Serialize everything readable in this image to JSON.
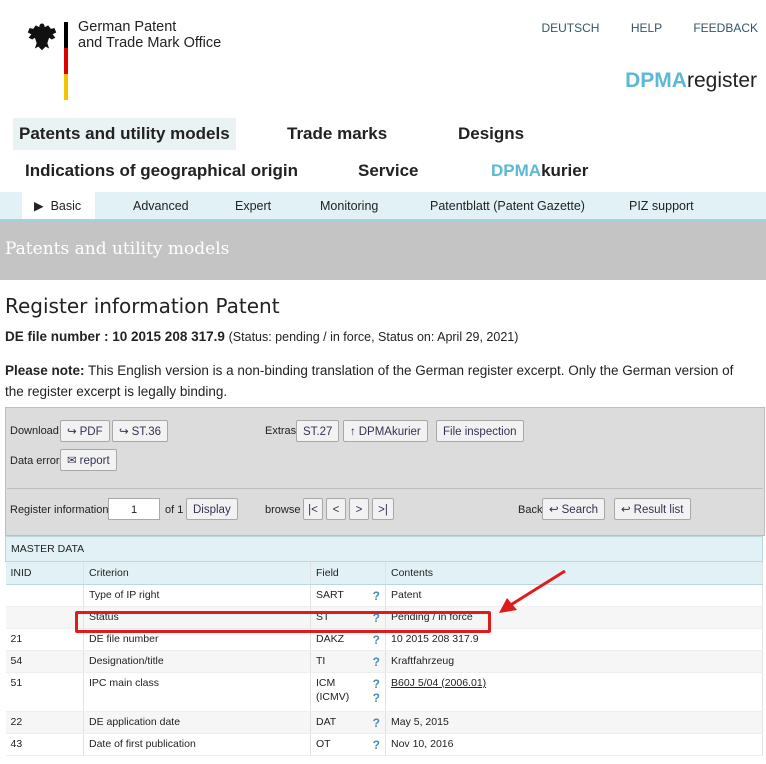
{
  "header": {
    "org_line1": "German Patent",
    "org_line2": "and Trade Mark Office",
    "links": [
      "DEUTSCH",
      "HELP",
      "FEEDBACK"
    ],
    "brand_a": "DPMA",
    "brand_b": "register",
    "colors": {
      "accent": "#5cb8d6",
      "flag": [
        "#000000",
        "#dd0000",
        "#f5c400"
      ]
    }
  },
  "main_nav": {
    "patents": "Patents and utility models",
    "trademarks": "Trade marks",
    "designs": "Designs",
    "geo": "Indications of geographical origin",
    "service": "Service",
    "kurier_a": "DPMA",
    "kurier_b": "kurier"
  },
  "sub_nav": {
    "basic": "Basic",
    "advanced": "Advanced",
    "expert": "Expert",
    "monitoring": "Monitoring",
    "gazette": "Patentblatt (Patent Gazette)",
    "piz": "PIZ support"
  },
  "band_title": "Patents and utility models",
  "page_title": "Register information Patent",
  "file": {
    "label": "DE file number : 10 2015 208 317.9",
    "status": "(Status: pending / in force, Status on: April 29, 2021)"
  },
  "note": {
    "bold": "Please note:",
    "text": " This English version is a non-binding translation of the German register excerpt. Only the German version of the register excerpt is legally binding."
  },
  "toolbar": {
    "download_label": "Download",
    "pdf": "PDF",
    "st36": "ST.36",
    "extras_label": "Extras",
    "st27": "ST.27",
    "dpmakurier": "DPMAkurier",
    "file_inspection": "File inspection",
    "data_error_label": "Data error",
    "report": "report",
    "register_info_label": "Register information",
    "page_value": "1",
    "of_label": "of 1",
    "display": "Display",
    "browse_label": "browse",
    "first": "|<",
    "prev": "<",
    "next": ">",
    "last": ">|",
    "back_label": "Back",
    "search": "Search",
    "result_list": "Result list"
  },
  "table": {
    "section": "MASTER DATA",
    "headers": {
      "inid": "INID",
      "criterion": "Criterion",
      "field": "Field",
      "contents": "Contents"
    },
    "rows": [
      {
        "inid": "",
        "criterion": "Type of IP right",
        "field": "SART",
        "field2": "",
        "contents": "Patent"
      },
      {
        "inid": "",
        "criterion": "Status",
        "field": "ST",
        "field2": "",
        "contents": "Pending / in force"
      },
      {
        "inid": "21",
        "criterion": "DE file number",
        "field": "DAKZ",
        "field2": "",
        "contents": "10 2015 208 317.9"
      },
      {
        "inid": "54",
        "criterion": "Designation/title",
        "field": "TI",
        "field2": "",
        "contents": "Kraftfahrzeug"
      },
      {
        "inid": "51",
        "criterion": "IPC main class",
        "field": "ICM",
        "field2": "(ICMV)",
        "contents": "B60J 5/04 (2006.01)"
      },
      {
        "inid": "22",
        "criterion": "DE application date",
        "field": "DAT",
        "field2": "",
        "contents": "May 5, 2015"
      },
      {
        "inid": "43",
        "criterion": "Date of first publication",
        "field": "OT",
        "field2": "",
        "contents": "Nov 10, 2016"
      }
    ],
    "help": "?"
  },
  "annotation": {
    "highlight_color": "#e01b1b"
  }
}
